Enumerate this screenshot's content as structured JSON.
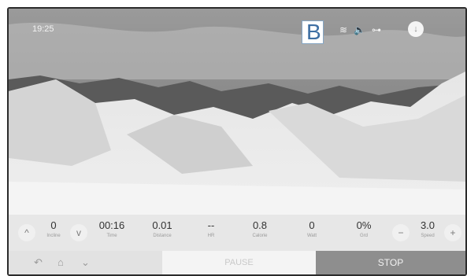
{
  "status_bar": {
    "time": "19:25",
    "overlay_letter": "B",
    "icons": [
      "wifi-icon",
      "volume-icon",
      "dumbbell-icon"
    ],
    "circle_icon": "arrow-icon"
  },
  "metrics": [
    {
      "value": "0",
      "label": "Incline"
    },
    {
      "value": "00:16",
      "label": "Time"
    },
    {
      "value": "0.01",
      "label": "Distance"
    },
    {
      "value": "--",
      "label": "HR"
    },
    {
      "value": "0.8",
      "label": "Calorie"
    },
    {
      "value": "0",
      "label": "Watt"
    },
    {
      "value": "0%",
      "label": "Grd"
    },
    {
      "value": "3.0",
      "label": "Speed"
    }
  ],
  "bottom": {
    "pause_label": "PAUSE",
    "stop_label": "STOP"
  }
}
